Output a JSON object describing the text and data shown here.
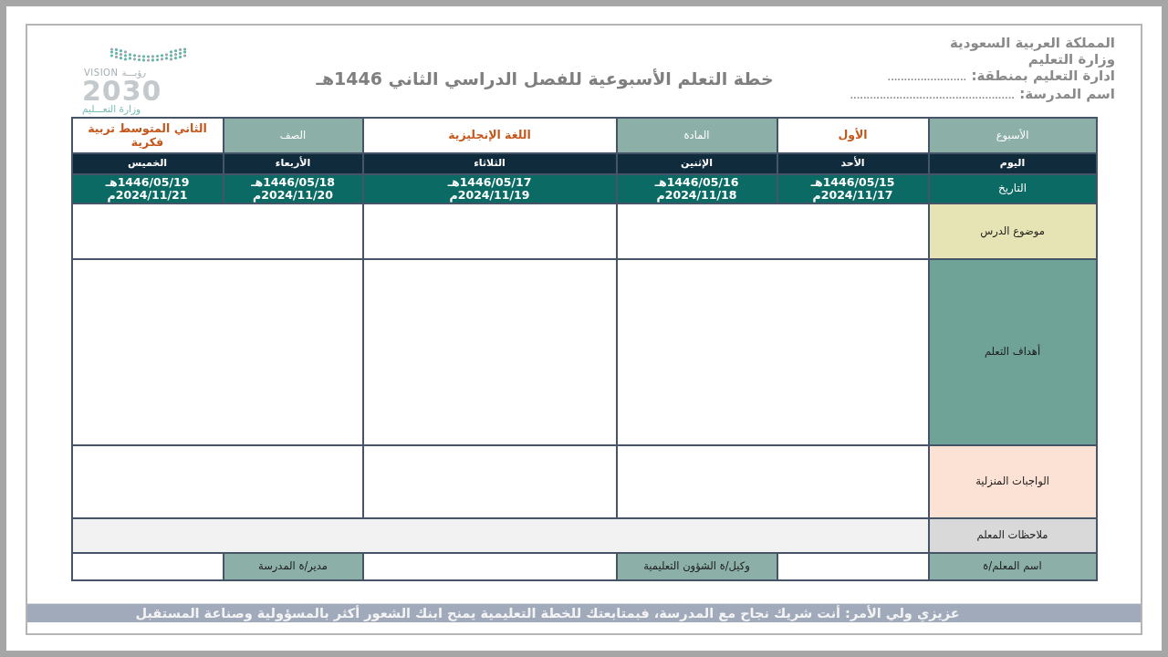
{
  "header": {
    "lines": [
      "المملكة العربية السعودية",
      "وزارة التعليم",
      "ادارة التعليم بمنطقة: ........................",
      "اسم المدرسة: .................................................."
    ]
  },
  "title": "خطة التعلم الأسبوعية للفصل الدراسي الثاني 1446هـ",
  "logo": {
    "latin_word": "VISION",
    "arabic_word": "رؤيـــة",
    "year": "2030",
    "ministry": "وزارة التعـــليم"
  },
  "plan": {
    "info_row": [
      {
        "kind": "label",
        "text": "الأسبوع"
      },
      {
        "kind": "value",
        "text": "الأول"
      },
      {
        "kind": "label",
        "text": "المادة"
      },
      {
        "kind": "value",
        "text": "اللغة الإنجليزية"
      },
      {
        "kind": "label",
        "text": "الصف"
      },
      {
        "kind": "value",
        "text": "الثاني المتوسط تربية فكرية"
      }
    ],
    "day_label": "اليوم",
    "date_label": "التاريخ",
    "days": [
      {
        "name": "الأحد",
        "hijri": "1446/05/15هـ",
        "gregorian": "2024/11/17م"
      },
      {
        "name": "الإثنين",
        "hijri": "1446/05/16هـ",
        "gregorian": "2024/11/18م"
      },
      {
        "name": "الثلاثاء",
        "hijri": "1446/05/17هـ",
        "gregorian": "2024/11/19م"
      },
      {
        "name": "الأربعاء",
        "hijri": "1446/05/18هـ",
        "gregorian": "2024/11/20م"
      },
      {
        "name": "الخميس",
        "hijri": "1446/05/19هـ",
        "gregorian": "2024/11/21م"
      }
    ],
    "sections": [
      {
        "kind": "topic",
        "label": "موضوع الدرس"
      },
      {
        "kind": "objectives",
        "label": "أهداف التعلم"
      },
      {
        "kind": "homework",
        "label": "الواجبات المنزلية"
      },
      {
        "kind": "notes",
        "label": "ملاحظات المعلم"
      }
    ],
    "signatures": [
      {
        "label": "اسم المعلم/ة"
      },
      {
        "label": "وكيل/ة الشؤون التعليمية"
      },
      {
        "label": "مدير/ة المدرسة"
      }
    ]
  },
  "footer": "عزيزي ولي الأمر: أنت شريك نجاح مع المدرسة، فبمتابعتك للخطة التعليمية يمنح ابنك الشعور أكثر بالمسؤولية وصناعة المستقبل"
}
